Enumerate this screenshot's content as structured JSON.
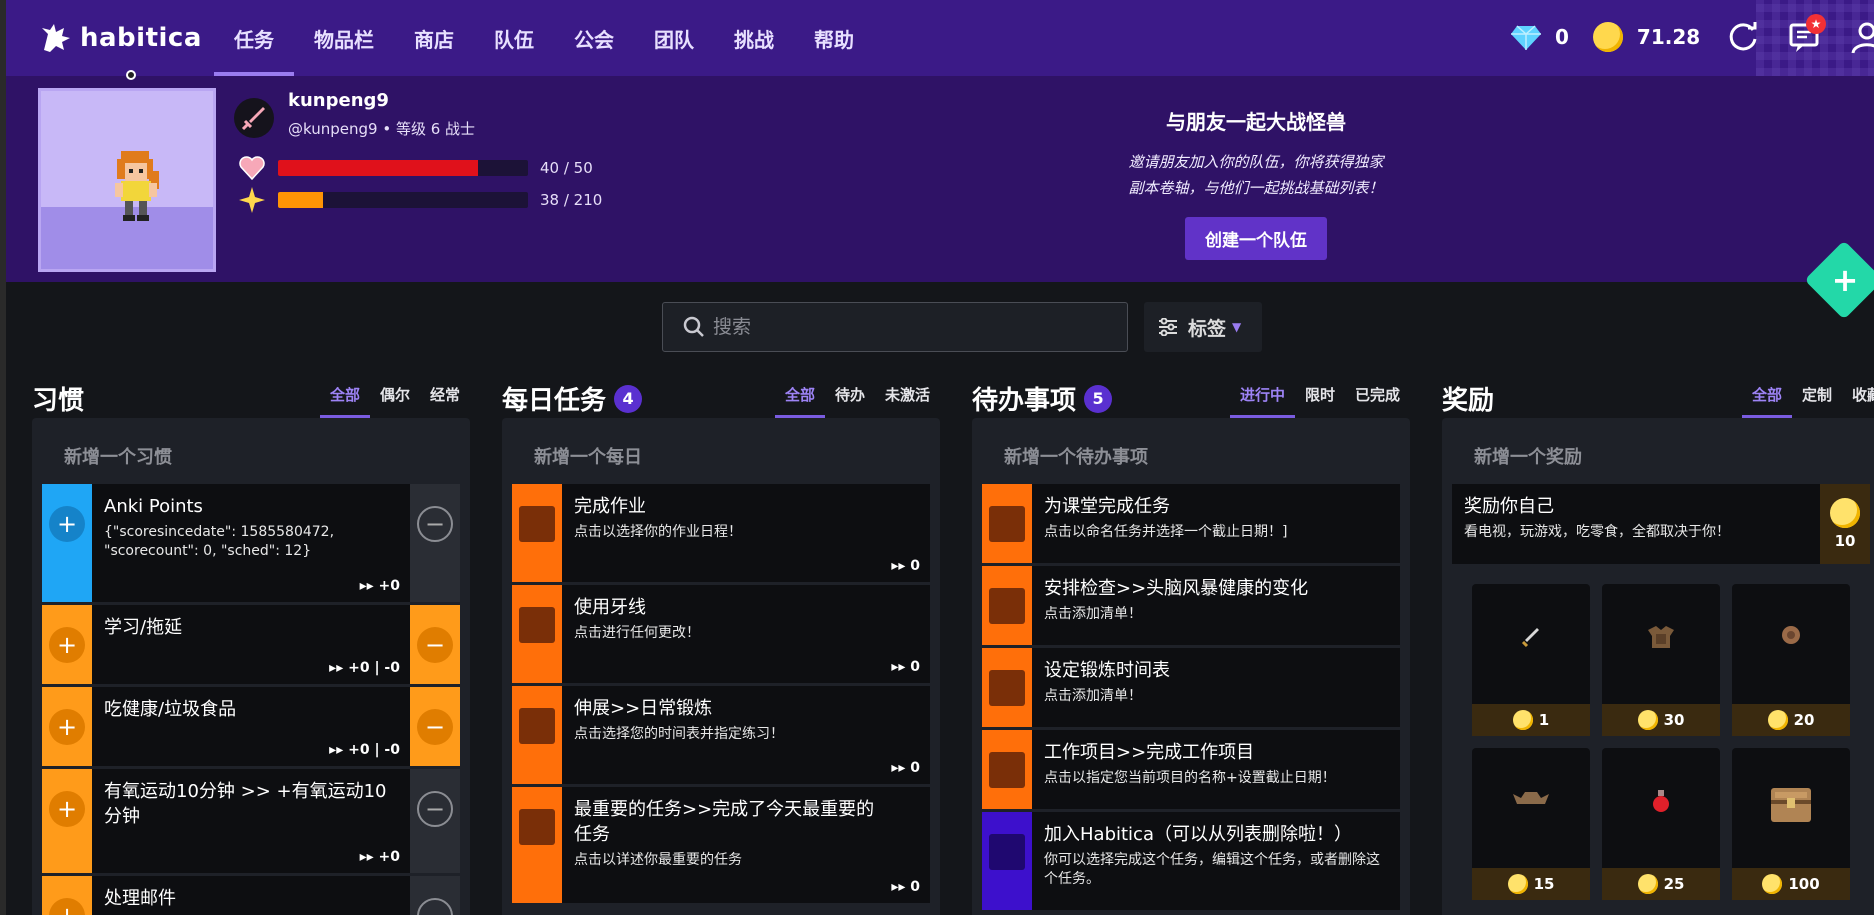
{
  "nav": {
    "logo_text": "habitica",
    "items": [
      "任务",
      "物品栏",
      "商店",
      "队伍",
      "公会",
      "团队",
      "挑战",
      "帮助"
    ],
    "gems": "0",
    "gold": "71.28",
    "notif_badge": "★"
  },
  "user": {
    "name": "kunpeng9",
    "handle_line": "@kunpeng9 • 等级 6 战士",
    "hp": {
      "text": "40 / 50",
      "value": 40,
      "max": 50,
      "color": "#e0111b"
    },
    "xp": {
      "text": "38 / 210",
      "value": 38,
      "max": 210,
      "color": "#ff9405"
    }
  },
  "party": {
    "title": "与朋友一起大战怪兽",
    "desc_line1": "邀请朋友加入你的队伍，你将获得独家",
    "desc_line2": "副本卷轴，与他们一起挑战基础列表！",
    "button": "创建一个队伍"
  },
  "search": {
    "placeholder": "搜索"
  },
  "tags_button": "标签",
  "columns": {
    "habits": {
      "title": "习惯",
      "filters": [
        "全部",
        "偶尔",
        "经常"
      ],
      "add": "新增一个习惯",
      "items": [
        {
          "title": "Anki Points",
          "notes": "{\"scoresincedate\": 1585580472, \"scorecount\": 0, \"sched\": 12}",
          "meta": "▸▸ +0"
        },
        {
          "title": "学习/拖延",
          "meta": "▸▸ +0 | -0"
        },
        {
          "title": "吃健康/垃圾食品",
          "meta": "▸▸ +0 | -0"
        },
        {
          "title": "有氧运动10分钟 >> +有氧运动10分钟",
          "meta": "▸▸ +0"
        },
        {
          "title": "处理邮件"
        }
      ]
    },
    "dailies": {
      "title": "每日任务",
      "count": "4",
      "filters": [
        "全部",
        "待办",
        "未激活"
      ],
      "add": "新增一个每日",
      "items": [
        {
          "title": "完成作业",
          "notes": "点击以选择你的作业日程！",
          "meta": "▸▸ 0"
        },
        {
          "title": "使用牙线",
          "notes": "点击进行任何更改！",
          "meta": "▸▸ 0"
        },
        {
          "title": "伸展>>日常锻炼",
          "notes": "点击选择您的时间表并指定练习！",
          "meta": "▸▸ 0"
        },
        {
          "title": "最重要的任务>>完成了今天最重要的任务",
          "notes": "点击以详述你最重要的任务",
          "meta": "▸▸ 0"
        }
      ]
    },
    "todos": {
      "title": "待办事项",
      "count": "5",
      "filters": [
        "进行中",
        "限时",
        "已完成"
      ],
      "add": "新增一个待办事项",
      "items": [
        {
          "title": "为课堂完成任务",
          "notes": "点击以命名任务并选择一个截止日期！]"
        },
        {
          "title": "安排检查>>头脑风暴健康的变化",
          "notes": "点击添加清单！"
        },
        {
          "title": "设定锻炼时间表",
          "notes": "点击添加清单！"
        },
        {
          "title": "工作项目>>完成工作项目",
          "notes": "点击以指定您当前项目的名称+设置截止日期！"
        },
        {
          "title": "加入Habitica（可以从列表删除啦！）",
          "notes": "你可以选择完成这个任务，编辑这个任务，或者删除这个任务。"
        }
      ]
    },
    "rewards": {
      "title": "奖励",
      "filters": [
        "全部",
        "定制",
        "收藏"
      ],
      "add": "新增一个奖励",
      "custom": {
        "title": "奖励你自己",
        "notes": "看电视，玩游戏，吃零食，全都取决于你！",
        "price": "10"
      },
      "items": [
        {
          "name": "sword-item",
          "price": "1"
        },
        {
          "name": "armor-item",
          "price": "30"
        },
        {
          "name": "shield-item",
          "price": "20"
        },
        {
          "name": "helmet-item",
          "price": "15"
        },
        {
          "name": "potion-item",
          "price": "25"
        },
        {
          "name": "chest-item",
          "price": "100"
        }
      ]
    }
  },
  "colors": {
    "nav_bg": "#3b1a87",
    "header_bg": "#2f1266",
    "habit_blue": "#1fa6f5",
    "habit_orange": "#ff9b1a",
    "daily_orange": "#ff6f0a",
    "todo_purple": "#3d10cc",
    "fab_teal": "#23d8a8"
  }
}
